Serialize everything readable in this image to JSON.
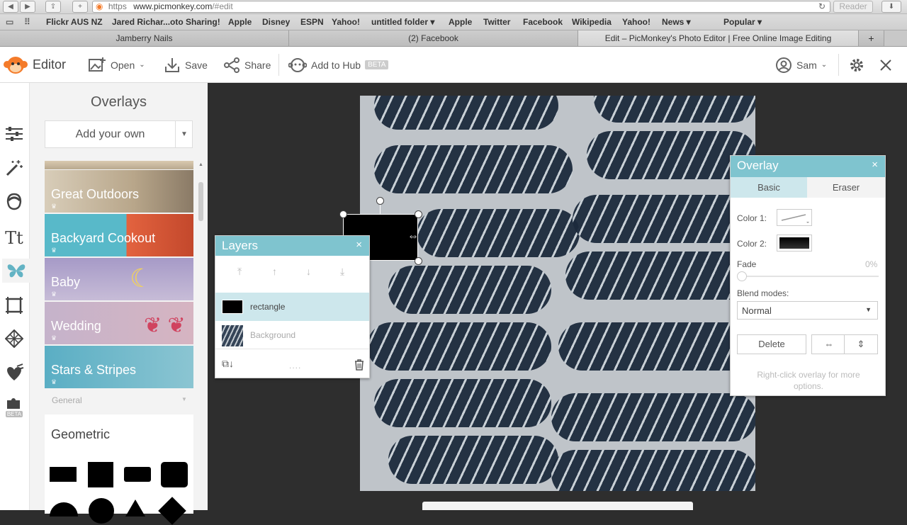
{
  "browser": {
    "url_scheme": "https",
    "url_host": "www.picmonkey.com",
    "url_path": "/#edit",
    "reader_label": "Reader",
    "bookmarks": [
      "Flickr AUS NZ",
      "Jared Richar...oto Sharing!",
      "Apple",
      "Disney",
      "ESPN",
      "Yahoo!",
      "untitled folder ▾",
      "Apple",
      "Twitter",
      "Facebook",
      "Wikipedia",
      "Yahoo!",
      "News ▾",
      "Popular ▾"
    ],
    "tabs": [
      "Jamberry Nails",
      "(2) Facebook",
      "Edit – PicMonkey's Photo Editor | Free Online Image Editing"
    ]
  },
  "toolbar": {
    "app_name": "Editor",
    "open_label": "Open",
    "save_label": "Save",
    "share_label": "Share",
    "hub_label": "Add to Hub",
    "hub_badge": "BETA",
    "user_name": "Sam"
  },
  "tools": {
    "beta_badge": "BETA"
  },
  "overlays_panel": {
    "title": "Overlays",
    "add_own_label": "Add your own",
    "categories": [
      "Great Outdoors",
      "Backyard Cookout",
      "Baby",
      "Wedding",
      "Stars & Stripes"
    ],
    "section_label": "General",
    "geometric_title": "Geometric"
  },
  "layers_panel": {
    "title": "Layers",
    "items": [
      "rectangle",
      "Background"
    ],
    "handle_dots": "...."
  },
  "overlay_panel": {
    "title": "Overlay",
    "tab_basic": "Basic",
    "tab_eraser": "Eraser",
    "color1_label": "Color 1:",
    "color2_label": "Color 2:",
    "fade_label": "Fade",
    "fade_value": "0%",
    "fade_level": 0,
    "blend_label": "Blend modes:",
    "blend_value": "Normal",
    "delete_label": "Delete",
    "hint": "Right-click overlay for more options."
  },
  "colors": {
    "accent": "#7fc4cf",
    "brand_orange": "#f47b2a",
    "overlay_fill": "#000000"
  }
}
